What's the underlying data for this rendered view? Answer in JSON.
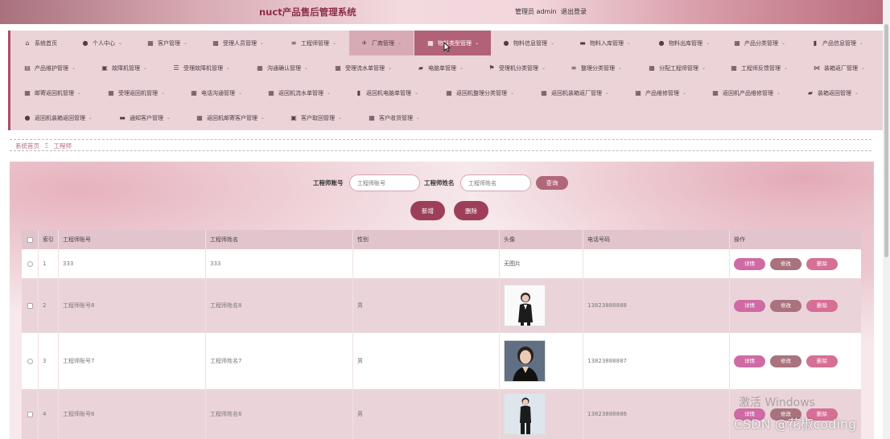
{
  "app": {
    "title": "nuct产品售后管理系统",
    "user_label": "管理员 admin",
    "logout_label": "退出登录"
  },
  "nav": {
    "rows": [
      [
        {
          "label": "系统首页",
          "icon": "home-icon",
          "glyph": "⌂"
        },
        {
          "label": "个人中心",
          "icon": "user-icon",
          "glyph": "●"
        },
        {
          "label": "客户管理",
          "icon": "grid-icon",
          "glyph": "▦"
        },
        {
          "label": "受理人员管理",
          "icon": "grid-icon",
          "glyph": "▦"
        },
        {
          "label": "工程师管理",
          "icon": "list-icon",
          "glyph": "≡"
        },
        {
          "label": "厂商管理",
          "icon": "plane-icon",
          "glyph": "✈"
        },
        {
          "label": "物料类型管理",
          "icon": "grid-icon",
          "glyph": "▦"
        },
        {
          "label": "物料信息管理",
          "icon": "user-icon",
          "glyph": "●"
        },
        {
          "label": "物料入库管理",
          "icon": "cup-icon",
          "glyph": "▬"
        },
        {
          "label": "物料出库管理",
          "icon": "user-icon",
          "glyph": "●"
        },
        {
          "label": "产品分类管理",
          "icon": "grid-icon",
          "glyph": "▦"
        },
        {
          "label": "产品信息管理",
          "icon": "chart-icon",
          "glyph": "▮"
        }
      ],
      [
        {
          "label": "产品维护管理",
          "icon": "doc-icon",
          "glyph": "▤"
        },
        {
          "label": "故障机管理",
          "icon": "bag-icon",
          "glyph": "▣"
        },
        {
          "label": "受理故障机管理",
          "icon": "sliders-icon",
          "glyph": "☰"
        },
        {
          "label": "沟通确认管理",
          "icon": "grid-icon",
          "glyph": "▦"
        },
        {
          "label": "受理流水单管理",
          "icon": "grid-icon",
          "glyph": "▦"
        },
        {
          "label": "电脑单管理",
          "icon": "truck-icon",
          "glyph": "▰"
        },
        {
          "label": "受理机分类管理",
          "icon": "flag-icon",
          "glyph": "⚑"
        },
        {
          "label": "整理分类管理",
          "icon": "list-icon",
          "glyph": "≡"
        },
        {
          "label": "分配工程师管理",
          "icon": "grid-icon",
          "glyph": "▦"
        },
        {
          "label": "工程师反馈管理",
          "icon": "grid-icon",
          "glyph": "▦"
        },
        {
          "label": "装箱返厂管理",
          "icon": "bow-icon",
          "glyph": "⋈"
        }
      ],
      [
        {
          "label": "邮寄返回机管理",
          "icon": "grid-icon",
          "glyph": "▦"
        },
        {
          "label": "受理返回机管理",
          "icon": "grid9-icon",
          "glyph": "▦"
        },
        {
          "label": "电话沟通管理",
          "icon": "grid-icon",
          "glyph": "▦"
        },
        {
          "label": "返回机流水单管理",
          "icon": "grid-icon",
          "glyph": "▦"
        },
        {
          "label": "返回机电脑单管理",
          "icon": "bar-chart-icon",
          "glyph": "▮"
        },
        {
          "label": "返回机整理分类管理",
          "icon": "grid-icon",
          "glyph": "▦"
        },
        {
          "label": "返回机装箱返厂管理",
          "icon": "grid-icon",
          "glyph": "▦"
        },
        {
          "label": "产品维修管理",
          "icon": "grid-icon",
          "glyph": "▦"
        },
        {
          "label": "返回机产品维修管理",
          "icon": "grid-icon",
          "glyph": "▦"
        },
        {
          "label": "装箱返回管理",
          "icon": "car-icon",
          "glyph": "▰"
        }
      ],
      [
        {
          "label": "返回机装箱返回管理",
          "icon": "pin-icon",
          "glyph": "●"
        },
        {
          "label": "通知客户管理",
          "icon": "monitor-icon",
          "glyph": "▬"
        },
        {
          "label": "返回机邮寄客户管理",
          "icon": "grid-icon",
          "glyph": "▦"
        },
        {
          "label": "客户取回管理",
          "icon": "box-icon",
          "glyph": "▣"
        },
        {
          "label": "客户收货管理",
          "icon": "grid-icon",
          "glyph": "▦"
        }
      ]
    ]
  },
  "breadcrumb": {
    "home": "系统首页",
    "separator": "Ξ",
    "current": "工程师"
  },
  "search": {
    "account_label": "工程师账号",
    "account_placeholder": "工程师账号",
    "name_label": "工程师姓名",
    "name_placeholder": "工程师姓名",
    "search_button": "查询"
  },
  "actions": {
    "add": "新增",
    "delete": "删除"
  },
  "table": {
    "headers": [
      "索引",
      "工程师账号",
      "工程师姓名",
      "性别",
      "头像",
      "电话号码",
      "操作"
    ],
    "rows": [
      {
        "index": "1",
        "account": "333",
        "name": "333",
        "sex": "",
        "avatar": "无图片",
        "phone": ""
      },
      {
        "index": "2",
        "account": "工程师账号8",
        "name": "工程师姓名8",
        "sex": "男",
        "avatar": "",
        "phone": "13823888888"
      },
      {
        "index": "3",
        "account": "工程师账号7",
        "name": "工程师姓名7",
        "sex": "男",
        "avatar": "",
        "phone": "13823888887"
      },
      {
        "index": "4",
        "account": "工程师账号6",
        "name": "工程师姓名6",
        "sex": "男",
        "avatar": "",
        "phone": "13823888886"
      }
    ],
    "op_labels": {
      "detail": "详情",
      "edit": "修改",
      "remove": "删除"
    }
  },
  "overlay": {
    "windows_watermark": "激活 Windows",
    "csdn_watermark": "CSDN @花椒coding"
  },
  "colors": {
    "accent": "#9e3f5a",
    "nav_bg": "#ebd3d8",
    "active_nav": "#b26277"
  }
}
